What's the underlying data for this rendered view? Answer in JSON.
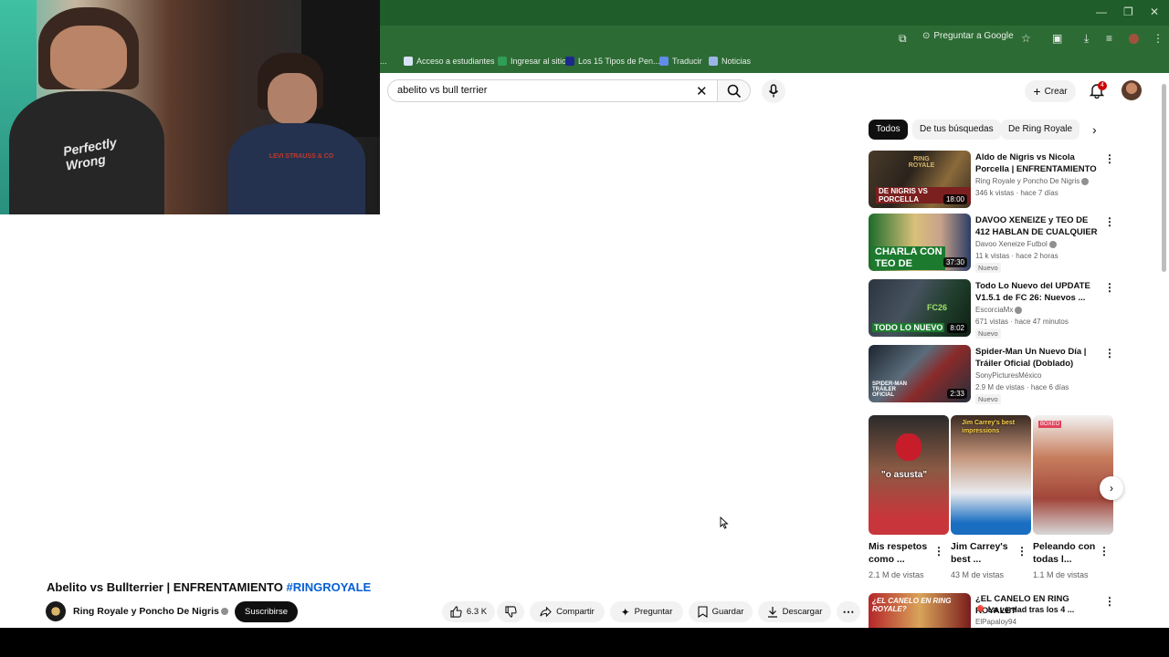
{
  "browser": {
    "ask_google": "Preguntar a Google",
    "bookmarks": [
      "Acceso a estudiantes",
      "Ingresar al sitio",
      "Los 15 Tipos de Pen...",
      "Traducir",
      "Noticias"
    ]
  },
  "youtube": {
    "search_value": "abelito vs bull terrier",
    "create_label": "Crear",
    "notification_count": "4"
  },
  "chips": [
    "Todos",
    "De tus búsquedas",
    "De Ring Royale"
  ],
  "recommendations": [
    {
      "title": "Aldo de Nigris vs Nicola Porcella | ENFRENTAMIENTO ...",
      "channel": "Ring Royale y Poncho De Nigris",
      "meta": "346 k vistas · hace 7 días",
      "duration": "18:00",
      "badge": ""
    },
    {
      "title": "DAVOO XENEIZE y TEO DE 412 HABLAN DE CUALQUIER COSA...",
      "channel": "Davoo Xeneize Futbol",
      "meta": "11 k vistas · hace 2 horas",
      "duration": "37:30",
      "badge": "Nuevo"
    },
    {
      "title": "Todo Lo Nuevo del UPDATE V1.5.1 de FC 26: Nuevos ...",
      "channel": "EscorciaMx",
      "meta": "671 vistas · hace 47 minutos",
      "duration": "8:02",
      "badge": "Nuevo"
    },
    {
      "title": "Spider-Man Un Nuevo Día | Tráiler Oficial (Doblado)",
      "channel": "SonyPicturesMéxico",
      "meta": "2.9 M de vistas · hace 6 días",
      "duration": "2:33",
      "badge": "Nuevo"
    }
  ],
  "thumb_text": {
    "r0_top": "RING ROYALE",
    "r0_names": "DE NIGRIS VS PORCELLA",
    "r1": "CHARLA CON TEO DE",
    "r2_a": "FC26",
    "r2_b": "TODO LO NUEVO",
    "r3": "SPIDER-MAN TRÁILER OFICIAL"
  },
  "shorts": [
    {
      "title": "Mis respetos como ...",
      "views": "2.1 M de vistas",
      "overlay": "\"o asusta\""
    },
    {
      "title": "Jim Carrey's best ...",
      "views": "43 M de vistas",
      "overlay": "Jim Carrey's best impressions"
    },
    {
      "title": "Peleando con todas l...",
      "views": "1.1 M de vistas",
      "overlay": "BOXEO"
    }
  ],
  "rec_bottom": {
    "title": "¿EL CANELO EN RING ROYALE?",
    "title2": "🎈 La verdad tras los 4 ...",
    "channel": "ElPapaloy94",
    "thumb_text": "¿EL CANELO EN RING ROYALE?"
  },
  "video": {
    "title": "Abelito vs Bullterrier | ENFRENTAMIENTO",
    "hashtag": "#RINGROYALE",
    "channel": "Ring Royale y Poncho De Nigris",
    "subscribe": "Suscribirse",
    "likes": "6.3 K",
    "share": "Compartir",
    "ask": "Preguntar",
    "save": "Guardar",
    "download": "Descargar"
  },
  "webcam_shirt_text": "Perfectly Wrong",
  "webcam_shirt_text_2": "LEVI STRAUSS & CO"
}
